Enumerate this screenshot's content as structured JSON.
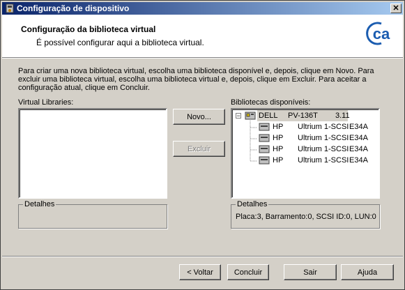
{
  "window": {
    "title": "Configuração de dispositivo",
    "close_label": "✕"
  },
  "header": {
    "title": "Configuração da biblioteca virtual",
    "subtitle": "É possível configurar aqui a biblioteca virtual.",
    "logo_text": "ca"
  },
  "instructions": "Para criar uma nova biblioteca virtual, escolha uma biblioteca disponível e, depois, clique em Novo. Para excluir uma biblioteca virtual, escolha uma biblioteca virtual e, depois, clique em Excluir. Para aceitar a configuração atual, clique em Concluir.",
  "virtual_libraries": {
    "label": "Virtual Libraries:",
    "items": []
  },
  "buttons": {
    "new": "Novo...",
    "delete": "Excluir"
  },
  "available_libraries": {
    "label": "Bibliotecas disponíveis:",
    "root": {
      "expander": "−",
      "vendor": "DELL",
      "model": "PV-136T",
      "firmware": "3.11"
    },
    "children": [
      {
        "vendor": "HP",
        "model": "Ultrium 1-SCSI",
        "firmware": "E34A"
      },
      {
        "vendor": "HP",
        "model": "Ultrium 1-SCSI",
        "firmware": "E34A"
      },
      {
        "vendor": "HP",
        "model": "Ultrium 1-SCSI",
        "firmware": "E34A"
      },
      {
        "vendor": "HP",
        "model": "Ultrium 1-SCSI",
        "firmware": "E34A"
      }
    ]
  },
  "details_left": {
    "label": "Detalhes",
    "text": ""
  },
  "details_right": {
    "label": "Detalhes",
    "text": "Placa:3, Barramento:0, SCSI ID:0, LUN:0"
  },
  "footer": {
    "back": "< Voltar",
    "finish": "Concluir",
    "exit": "Sair",
    "help": "Ajuda"
  },
  "colors": {
    "title_start": "#0a246a",
    "title_end": "#a6caf0",
    "logo_blue": "#1a5cb0",
    "face": "#d4d0c8"
  }
}
